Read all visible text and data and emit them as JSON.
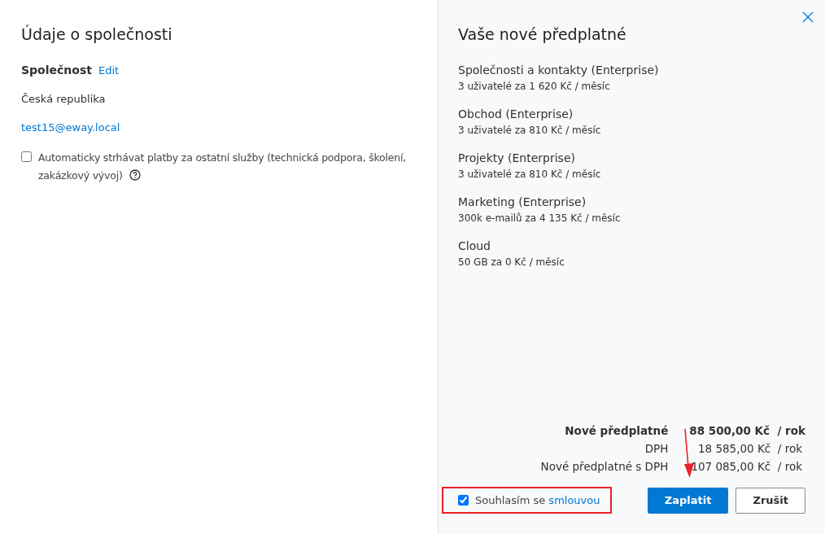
{
  "company_panel": {
    "title": "Údaje o společnosti",
    "company_label": "Společnost",
    "edit_link": "Edit",
    "country": "Česká republika",
    "email": "test15@eway.local",
    "auto_payment": {
      "label": "Automaticky strhávat platby za ostatní služby (technická podpora, školení, zakázkový vývoj)",
      "checked": false
    }
  },
  "subscription_panel": {
    "title": "Vaše nové předplatné",
    "items": [
      {
        "name": "Společnosti a kontakty (Enterprise)",
        "detail": "3 uživatelé za 1 620 Kč / měsíc"
      },
      {
        "name": "Obchod (Enterprise)",
        "detail": "3 uživatelé za 810 Kč / měsíc"
      },
      {
        "name": "Projekty (Enterprise)",
        "detail": "3 uživatelé za 810 Kč / měsíc"
      },
      {
        "name": "Marketing (Enterprise)",
        "detail": "300k e-mailů za 4 135 Kč / měsíc"
      },
      {
        "name": "Cloud",
        "detail": "50 GB za 0 Kč / měsíc"
      }
    ],
    "totals": [
      {
        "label": "Nové předplatné",
        "value": "88 500,00 Kč  / rok",
        "bold": true
      },
      {
        "label": "DPH",
        "value": "18 585,00 Kč  / rok",
        "bold": false
      },
      {
        "label": "Nové předplatné s DPH",
        "value": "107 085,00 Kč  / rok",
        "bold": false
      }
    ],
    "agreement": {
      "text": "Souhlasím se",
      "link": "smlouvou",
      "checked": true
    },
    "buttons": [
      {
        "label": "Zaplatit",
        "kind": "primary"
      },
      {
        "label": "Zrušit",
        "kind": "secondary"
      }
    ]
  }
}
